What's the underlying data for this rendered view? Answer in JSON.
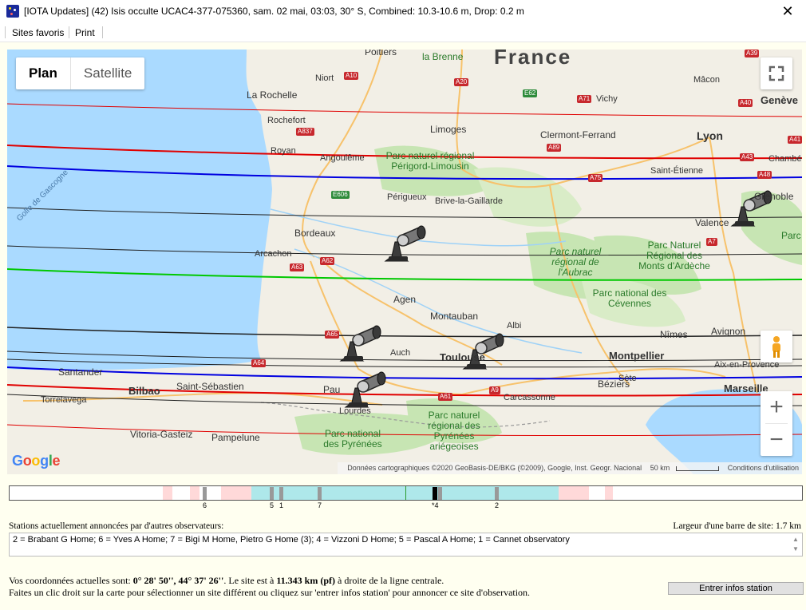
{
  "window": {
    "title": "[IOTA Updates] (42) Isis occulte UCAC4-377-075360, sam. 02 mai, 03:03, 30° S, Combined: 10.3-10.6 m, Drop:  0.2 m",
    "close_glyph": "✕"
  },
  "menu": {
    "items": [
      "Sites favoris",
      "Print"
    ]
  },
  "map": {
    "type_buttons": [
      "Plan",
      "Satellite"
    ],
    "zoom_in": "+",
    "zoom_out": "−",
    "labels": {
      "country": "France",
      "poitiers": "Poitiers",
      "brenne": "la Brenne",
      "niort": "Niort",
      "larochelle": "La Rochelle",
      "vichy": "Vichy",
      "macon": "Mâcon",
      "geneve": "Genève",
      "rochefort": "Rochefort",
      "limoges": "Limoges",
      "clermont": "Clermont-Ferrand",
      "lyon": "Lyon",
      "royan": "Royan",
      "angouleme": "Angoulême",
      "pnr_perigord": "Parc naturel régional Périgord-Limousin",
      "saintetienne": "Saint-Étienne",
      "chambery": "Chambé",
      "golfe": "Golfe de Gascogne",
      "perigueux": "Périgueux",
      "brive": "Brive-la-Gaillarde",
      "grenoble": "Grenoble",
      "bordeaux": "Bordeaux",
      "valence": "Valence",
      "arcachon": "Arcachon",
      "pnr_aubrac": "Parc naturel régional de l'Aubrac",
      "pnr_monts": "Parc Naturel Régional des Monts d'Ardèche",
      "agen": "Agen",
      "montauban": "Montauban",
      "albi": "Albi",
      "pnr_cevennes": "Parc national des Cévennes",
      "auch": "Auch",
      "toulouse": "Toulouse",
      "nimes": "Nîmes",
      "avignon": "Avignon",
      "montpellier": "Montpellier",
      "aix": "Aix-en-Provence",
      "santander": "Santander",
      "sete": "Sète",
      "bilbao": "Bilbao",
      "saintsebastien": "Saint-Sébastien",
      "pau": "Pau",
      "beziers": "Béziers",
      "marseille": "Marseille",
      "torrelavega": "Torrelavega",
      "carcassonne": "Carcassonne",
      "lourdes": "Lourdes",
      "vitoria": "Vitoria-Gasteiz",
      "pampelune": "Pampelune",
      "pnr_pyrenees_ariege": "Parc naturel régional des Pyrénées ariégeoises",
      "pn_pyrenees": "Parc national des Pyrénées",
      "parc_partial": "Parc"
    },
    "roads": [
      "A10",
      "A20",
      "E62",
      "A71",
      "A39",
      "A40",
      "A837",
      "A89",
      "A41",
      "A43",
      "A48",
      "E606",
      "A75",
      "A62",
      "A63",
      "A7",
      "A65",
      "A64",
      "A61",
      "A9"
    ],
    "google_logo": "Google",
    "attribution": {
      "data": "Données cartographiques ©2020 GeoBasis-DE/BKG (©2009), Google, Inst. Geogr. Nacional",
      "scale": "50 km",
      "terms": "Conditions d'utilisation"
    },
    "colors": {
      "water": "#aadaff",
      "land": "#f2efe6",
      "park": "#c7e5b3",
      "red": "#e00000",
      "blue": "#0000e0",
      "green": "#00c800",
      "black": "#202020"
    }
  },
  "timeline": {
    "tick_labels": [
      "6",
      "5",
      "1",
      "7",
      "*4",
      "2"
    ]
  },
  "stations": {
    "label": "Stations actuellement annoncées par d'autres observateurs:",
    "bar_width_label": "Largeur d'une barre de site: 1.7 km",
    "list": "2 = Brabant G Home; 6 = Yves A Home; 7 = Bigi M Home, Pietro G Home (3); 4 = Vizzoni D Home; 5 = Pascal A Home; 1 = Cannet observatory"
  },
  "footer": {
    "coords_prefix": "Vos coordonnées actuelles sont: ",
    "coords_value": "0° 28' 50'', 44° 37' 26''",
    "coords_mid": ". Le site est à ",
    "distance": "11.343 km (pf)",
    "coords_suffix": " à droite de la ligne centrale.",
    "instruction": "Faites un clic droit sur la carte pour sélectionner un site différent ou cliquez sur 'entrer infos station' pour annoncer ce site d'observation.",
    "button": "Entrer infos station"
  }
}
